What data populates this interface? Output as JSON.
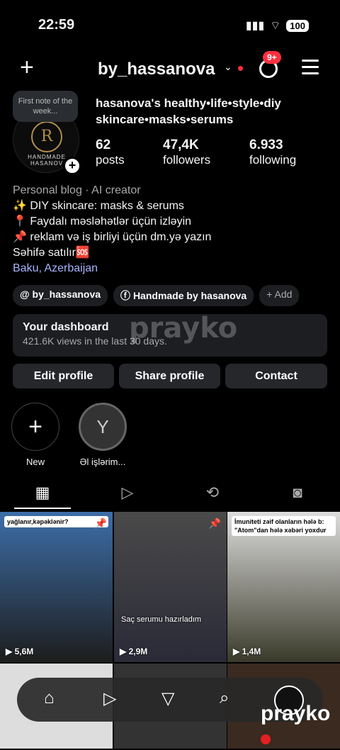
{
  "status_bar": {
    "time": "22:59",
    "battery": "100"
  },
  "header": {
    "username": "by_hassanova",
    "notification_badge": "9+"
  },
  "profile": {
    "note": "First note of the week...",
    "avatar_letter": "R",
    "avatar_text": "HANDMADE HASANOV",
    "full_name": "hasanova's healthy•life•style•diy skincare•masks•serums",
    "stats": [
      {
        "value": "62",
        "label": "posts"
      },
      {
        "value": "47,4K",
        "label": "followers"
      },
      {
        "value": "6.933",
        "label": "following"
      }
    ],
    "category": "Personal blog · AI creator",
    "bio_lines": [
      "✨ DIY skincare: masks & serums",
      "📍 Faydalı məsləhətlər üçün izləyin",
      "📌 reklam və iş birliyi üçün dm.yə yazın",
      "Səhifə satılır🆘"
    ],
    "location": "Baku, Azerbaijan"
  },
  "chips": [
    {
      "label": "by_hassanova"
    },
    {
      "label": "Handmade by hasanova"
    },
    {
      "label": "+ Add"
    }
  ],
  "dashboard": {
    "title": "Your dashboard",
    "subtitle": "421.6K views in the last 30 days."
  },
  "buttons": {
    "edit": "Edit profile",
    "share": "Share profile",
    "contact": "Contact"
  },
  "highlights": [
    {
      "label": "New"
    },
    {
      "label": "Əl işlərim..."
    }
  ],
  "posts": [
    {
      "caption": "yağlanır,kəpəklənir?",
      "views": "5,6M",
      "overlay": ""
    },
    {
      "caption": "",
      "views": "2,9M",
      "overlay": "Saç serumu hazırladım"
    },
    {
      "caption": "İmuniteti zəif olanların hələ b: \"Atom\"dan hələ xəbəri yoxdur",
      "views": "1,4M",
      "overlay": ""
    }
  ],
  "watermark": "prayko",
  "colors": {
    "accent_red": "#ff3040",
    "link": "#a8b4ff",
    "chip_bg": "#1c1e21"
  }
}
